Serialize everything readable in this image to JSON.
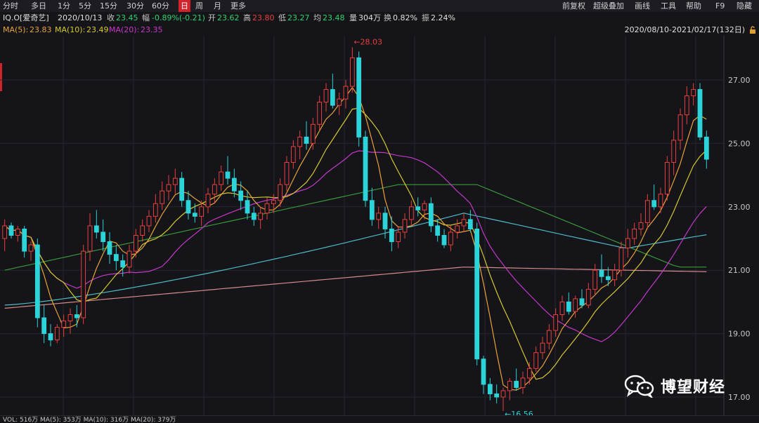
{
  "toolbar": {
    "left_items": [
      "分时",
      "多日",
      "1分",
      "5分",
      "15分",
      "30分",
      "60分",
      "日",
      "周",
      "月",
      "更多"
    ],
    "active_item": "日",
    "right_items": [
      "前复权",
      "超级叠加",
      "画线",
      "工具",
      "帮助",
      "F9",
      "隐藏"
    ]
  },
  "info": {
    "symbol": "IQ.O[爱奇艺]",
    "date": "2020/10/13",
    "close_label": "收",
    "close": "23.45",
    "change_label": "幅",
    "change": "-0.89%(-0.21)",
    "open_label": "开",
    "open": "23.62",
    "high_label": "高",
    "high": "23.80",
    "low_label": "低",
    "low": "23.27",
    "avg_label": "均",
    "avg": "23.48",
    "volume_label": "量",
    "volume": "304万",
    "turnover_label": "换",
    "turnover": "0.82%",
    "amplitude_label": "振",
    "amplitude": "2.24%"
  },
  "ma": {
    "ma5_label": "MA(5):",
    "ma5": "23.83",
    "ma10_label": "MA(10):",
    "ma10": "23.49",
    "ma20_label": "MA(20):",
    "ma20": "23.35"
  },
  "range_text": "2020/08/10-2021/02/17(132日)",
  "watermark": "博望财经",
  "bottom_text": "VOL: 516万 MA(5): 353万 MA(10): 316万 MA(20): 379万",
  "colors": {
    "up": "#e8413f",
    "down": "#2cd3d8",
    "ma5": "#e8a33a",
    "ma10": "#d6c92f",
    "ma20": "#c538c9",
    "ma60": "#3a9a3a",
    "ma120": "#4fbcc8",
    "ma250": "#d88a8a",
    "price_high_label": "#e8413f",
    "price_low_label": "#2cd3d8",
    "background": "#141419"
  },
  "chart_data": {
    "type": "candlestick",
    "period": "daily",
    "date_range": [
      "2020/08/10",
      "2021/02/17"
    ],
    "y_axis": {
      "ticks": [
        "27.00",
        "25.00",
        "23.00",
        "21.00",
        "19.00",
        "17.00"
      ],
      "range": [
        16.2,
        28.6
      ]
    },
    "grid": true,
    "annotations": [
      {
        "text": "28.03",
        "value": 28.03,
        "type": "high"
      },
      {
        "text": "16.56",
        "value": 16.56,
        "type": "low"
      }
    ],
    "ohlc": [
      [
        22.0,
        22.6,
        21.6,
        22.4
      ],
      [
        22.4,
        22.5,
        22.0,
        22.1
      ],
      [
        22.1,
        22.4,
        21.9,
        22.3
      ],
      [
        22.3,
        22.4,
        21.4,
        21.6
      ],
      [
        21.6,
        21.9,
        21.3,
        21.8
      ],
      [
        21.8,
        22.0,
        19.2,
        19.5
      ],
      [
        19.5,
        19.9,
        18.7,
        19.0
      ],
      [
        19.0,
        19.3,
        18.6,
        18.8
      ],
      [
        18.8,
        19.3,
        18.7,
        19.2
      ],
      [
        19.2,
        19.6,
        18.9,
        19.4
      ],
      [
        19.4,
        19.8,
        19.0,
        19.6
      ],
      [
        19.6,
        19.9,
        19.2,
        19.5
      ],
      [
        19.5,
        21.8,
        19.3,
        21.6
      ],
      [
        21.6,
        22.8,
        21.3,
        22.4
      ],
      [
        22.4,
        22.9,
        22.0,
        22.2
      ],
      [
        22.2,
        22.6,
        21.6,
        21.9
      ],
      [
        21.9,
        22.2,
        21.2,
        21.5
      ],
      [
        21.5,
        21.8,
        21.0,
        21.3
      ],
      [
        21.3,
        21.5,
        20.8,
        21.1
      ],
      [
        21.1,
        21.8,
        20.9,
        21.6
      ],
      [
        21.6,
        22.3,
        21.4,
        22.1
      ],
      [
        22.1,
        22.6,
        21.9,
        22.4
      ],
      [
        22.4,
        22.9,
        22.2,
        22.7
      ],
      [
        22.7,
        23.4,
        22.5,
        23.1
      ],
      [
        23.1,
        23.8,
        22.9,
        23.5
      ],
      [
        23.5,
        24.0,
        23.2,
        23.7
      ],
      [
        23.7,
        24.2,
        23.4,
        23.9
      ],
      [
        23.9,
        24.1,
        23.0,
        23.2
      ],
      [
        23.2,
        23.5,
        22.6,
        22.8
      ],
      [
        22.8,
        23.1,
        22.5,
        22.7
      ],
      [
        22.7,
        23.2,
        22.4,
        23.0
      ],
      [
        23.0,
        23.6,
        22.8,
        23.4
      ],
      [
        23.4,
        23.9,
        23.1,
        23.7
      ],
      [
        23.7,
        24.3,
        23.5,
        24.1
      ],
      [
        24.1,
        24.6,
        23.7,
        23.9
      ],
      [
        23.9,
        24.2,
        23.3,
        23.5
      ],
      [
        23.5,
        23.8,
        22.9,
        23.2
      ],
      [
        23.2,
        23.5,
        22.6,
        22.8
      ],
      [
        22.8,
        23.0,
        22.4,
        22.6
      ],
      [
        22.6,
        23.0,
        22.3,
        22.8
      ],
      [
        22.8,
        23.3,
        22.6,
        23.1
      ],
      [
        23.1,
        23.4,
        22.8,
        23.2
      ],
      [
        23.2,
        23.9,
        23.0,
        23.7
      ],
      [
        23.7,
        24.6,
        23.5,
        24.4
      ],
      [
        24.4,
        25.1,
        24.2,
        24.9
      ],
      [
        24.9,
        25.4,
        24.5,
        25.2
      ],
      [
        25.2,
        25.7,
        24.8,
        25.0
      ],
      [
        25.0,
        25.8,
        24.8,
        25.6
      ],
      [
        25.6,
        26.5,
        25.4,
        26.3
      ],
      [
        26.3,
        26.9,
        26.0,
        26.7
      ],
      [
        26.7,
        27.2,
        26.1,
        26.2
      ],
      [
        26.2,
        26.6,
        25.9,
        26.4
      ],
      [
        26.4,
        27.0,
        26.1,
        26.8
      ],
      [
        26.8,
        28.03,
        26.6,
        27.7
      ],
      [
        27.7,
        27.9,
        24.9,
        25.2
      ],
      [
        25.2,
        25.4,
        23.0,
        23.2
      ],
      [
        23.2,
        23.6,
        22.4,
        22.6
      ],
      [
        22.6,
        23.0,
        22.3,
        22.8
      ],
      [
        22.8,
        23.0,
        22.0,
        22.3
      ],
      [
        22.3,
        22.7,
        21.6,
        21.9
      ],
      [
        21.9,
        22.4,
        21.7,
        22.2
      ],
      [
        22.2,
        22.8,
        22.0,
        22.6
      ],
      [
        22.6,
        23.2,
        22.4,
        23.0
      ],
      [
        23.0,
        23.3,
        22.7,
        22.9
      ],
      [
        22.9,
        23.2,
        22.6,
        23.1
      ],
      [
        23.1,
        23.3,
        22.2,
        22.4
      ],
      [
        22.4,
        22.6,
        21.9,
        22.1
      ],
      [
        22.1,
        22.3,
        21.7,
        21.8
      ],
      [
        21.8,
        22.4,
        21.6,
        22.2
      ],
      [
        22.2,
        22.6,
        22.0,
        22.4
      ],
      [
        22.4,
        22.8,
        22.2,
        22.6
      ],
      [
        22.6,
        22.9,
        22.2,
        22.3
      ],
      [
        22.3,
        22.5,
        18.0,
        18.2
      ],
      [
        18.2,
        18.3,
        17.1,
        17.4
      ],
      [
        17.4,
        17.6,
        16.9,
        17.1
      ],
      [
        17.1,
        17.4,
        16.8,
        17.0
      ],
      [
        17.0,
        17.3,
        16.56,
        17.2
      ],
      [
        17.2,
        17.6,
        16.9,
        17.5
      ],
      [
        17.5,
        17.9,
        17.2,
        17.3
      ],
      [
        17.3,
        17.8,
        17.1,
        17.6
      ],
      [
        17.6,
        18.1,
        17.4,
        17.9
      ],
      [
        17.9,
        18.6,
        17.8,
        18.4
      ],
      [
        18.4,
        18.9,
        18.2,
        18.7
      ],
      [
        18.7,
        19.3,
        18.5,
        19.1
      ],
      [
        19.1,
        19.8,
        18.9,
        19.6
      ],
      [
        19.6,
        20.2,
        19.4,
        20.0
      ],
      [
        20.0,
        20.3,
        19.6,
        19.7
      ],
      [
        19.7,
        20.2,
        19.5,
        20.1
      ],
      [
        20.1,
        20.4,
        19.8,
        19.9
      ],
      [
        19.9,
        20.6,
        19.8,
        20.4
      ],
      [
        20.4,
        21.2,
        20.2,
        21.0
      ],
      [
        21.0,
        21.5,
        20.6,
        20.8
      ],
      [
        20.8,
        21.1,
        20.5,
        20.7
      ],
      [
        20.7,
        21.2,
        20.5,
        21.0
      ],
      [
        21.0,
        21.9,
        20.8,
        21.7
      ],
      [
        21.7,
        22.3,
        21.4,
        22.0
      ],
      [
        22.0,
        22.5,
        21.8,
        22.3
      ],
      [
        22.3,
        22.8,
        22.1,
        22.5
      ],
      [
        22.5,
        23.4,
        22.3,
        23.2
      ],
      [
        23.2,
        23.7,
        22.9,
        23.0
      ],
      [
        23.0,
        23.6,
        22.8,
        23.4
      ],
      [
        23.4,
        24.6,
        23.2,
        24.4
      ],
      [
        24.4,
        25.4,
        24.0,
        25.1
      ],
      [
        25.1,
        26.1,
        24.8,
        25.9
      ],
      [
        25.9,
        26.8,
        25.6,
        26.5
      ],
      [
        26.5,
        26.9,
        26.2,
        26.7
      ],
      [
        26.7,
        26.9,
        25.1,
        25.2
      ],
      [
        25.2,
        25.4,
        24.2,
        24.5
      ]
    ]
  }
}
